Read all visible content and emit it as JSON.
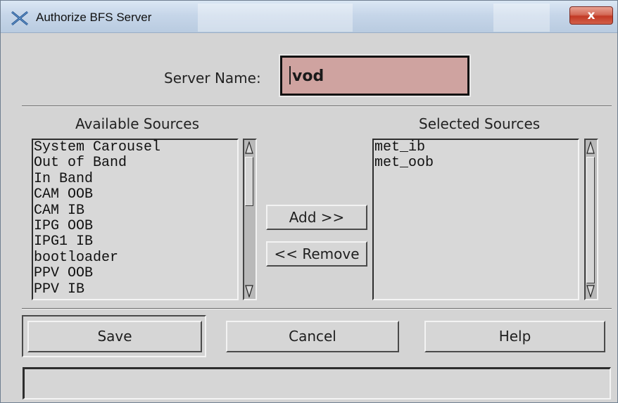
{
  "window": {
    "title": "Authorize BFS Server",
    "close_glyph": "x",
    "app_icon": "x-window-icon"
  },
  "server": {
    "label": "Server Name:",
    "value": "vod"
  },
  "available": {
    "header": "Available Sources",
    "items": [
      "System Carousel",
      "Out of Band",
      "In Band",
      "CAM OOB",
      "CAM IB",
      "IPG OOB",
      "IPG1 IB",
      "bootloader",
      "PPV OOB",
      "PPV IB"
    ]
  },
  "selected": {
    "header": "Selected Sources",
    "items": [
      "met_ib",
      "met_oob"
    ]
  },
  "transfer": {
    "add_label": "Add >>",
    "remove_label": "<< Remove"
  },
  "actions": {
    "save_label": "Save",
    "cancel_label": "Cancel",
    "help_label": "Help"
  },
  "status": {
    "message": ""
  },
  "colors": {
    "dialog_bg": "#d4d4d4",
    "server_field_bg": "#cfa3a0",
    "close_button": "#c94a34"
  }
}
